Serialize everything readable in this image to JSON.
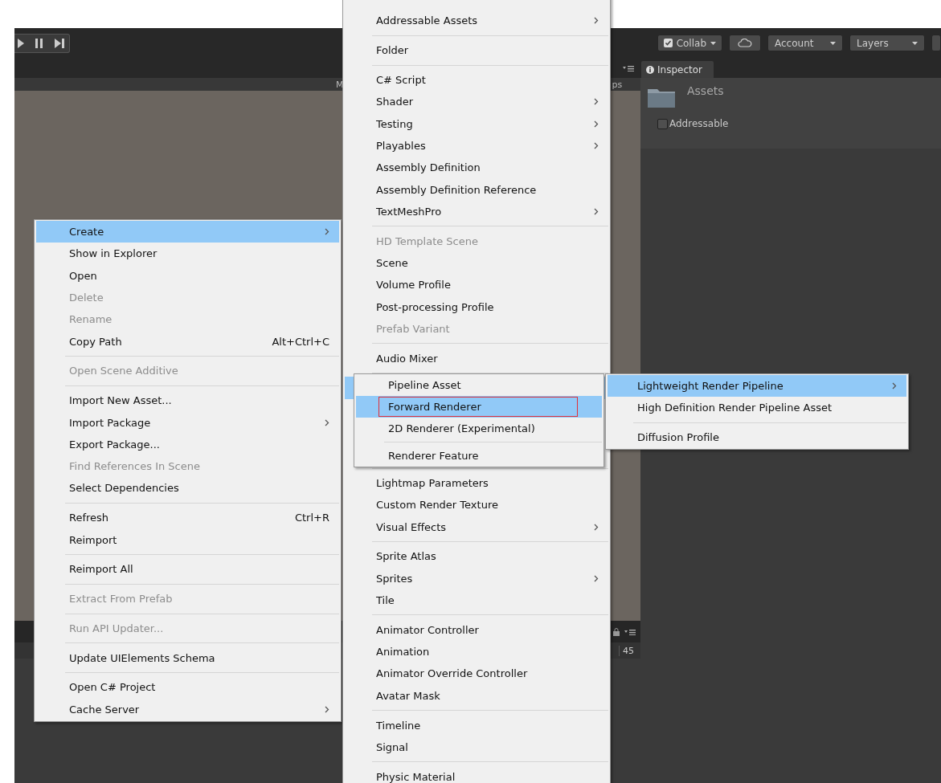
{
  "toolbar": {
    "buttons": [
      {
        "kind": "check_dropdown",
        "label": "Collab"
      },
      {
        "kind": "cloud"
      },
      {
        "kind": "dropdown",
        "label": "Account"
      },
      {
        "kind": "dropdown",
        "label": "Layers"
      }
    ]
  },
  "scene_panel": {
    "header_texts": [
      "M",
      "ps"
    ]
  },
  "inspector": {
    "tab": "Inspector",
    "asset_name": "Assets",
    "addressable": {
      "label": "Addressable",
      "checked": false
    }
  },
  "bottom_panel": {
    "count": "45"
  },
  "context_menu": {
    "items": [
      {
        "kind": "item",
        "label": "Create",
        "selected": true,
        "disabled": false,
        "submenu": true
      },
      {
        "kind": "item",
        "label": "Show in Explorer",
        "selected": false,
        "disabled": false,
        "submenu": false
      },
      {
        "kind": "item",
        "label": "Open",
        "selected": false,
        "disabled": false,
        "submenu": false
      },
      {
        "kind": "item",
        "label": "Delete",
        "selected": false,
        "disabled": true,
        "submenu": false
      },
      {
        "kind": "item",
        "label": "Rename",
        "selected": false,
        "disabled": true,
        "submenu": false
      },
      {
        "kind": "item",
        "label": "Copy Path",
        "shortcut": "Alt+Ctrl+C",
        "selected": false,
        "disabled": false,
        "submenu": false
      },
      {
        "kind": "separator"
      },
      {
        "kind": "item",
        "label": "Open Scene Additive",
        "selected": false,
        "disabled": true,
        "submenu": false
      },
      {
        "kind": "separator"
      },
      {
        "kind": "item",
        "label": "Import New Asset...",
        "selected": false,
        "disabled": false,
        "submenu": false
      },
      {
        "kind": "item",
        "label": "Import Package",
        "selected": false,
        "disabled": false,
        "submenu": true
      },
      {
        "kind": "item",
        "label": "Export Package...",
        "selected": false,
        "disabled": false,
        "submenu": false
      },
      {
        "kind": "item",
        "label": "Find References In Scene",
        "selected": false,
        "disabled": true,
        "submenu": false
      },
      {
        "kind": "item",
        "label": "Select Dependencies",
        "selected": false,
        "disabled": false,
        "submenu": false
      },
      {
        "kind": "separator"
      },
      {
        "kind": "item",
        "label": "Refresh",
        "shortcut": "Ctrl+R",
        "selected": false,
        "disabled": false,
        "submenu": false
      },
      {
        "kind": "item",
        "label": "Reimport",
        "selected": false,
        "disabled": false,
        "submenu": false
      },
      {
        "kind": "separator"
      },
      {
        "kind": "item",
        "label": "Reimport All",
        "selected": false,
        "disabled": false,
        "submenu": false
      },
      {
        "kind": "separator"
      },
      {
        "kind": "item",
        "label": "Extract From Prefab",
        "selected": false,
        "disabled": true,
        "submenu": false
      },
      {
        "kind": "separator"
      },
      {
        "kind": "item",
        "label": "Run API Updater...",
        "selected": false,
        "disabled": true,
        "submenu": false
      },
      {
        "kind": "separator"
      },
      {
        "kind": "item",
        "label": "Update UIElements Schema",
        "selected": false,
        "disabled": false,
        "submenu": false
      },
      {
        "kind": "separator"
      },
      {
        "kind": "item",
        "label": "Open C# Project",
        "selected": false,
        "disabled": false,
        "submenu": false
      },
      {
        "kind": "item",
        "label": "Cache Server",
        "selected": false,
        "disabled": false,
        "submenu": true
      }
    ]
  },
  "create_menu": {
    "items": [
      {
        "kind": "blank"
      },
      {
        "kind": "item",
        "label": "Addressable Assets",
        "selected": false,
        "disabled": false,
        "submenu": true
      },
      {
        "kind": "separator"
      },
      {
        "kind": "item",
        "label": "Folder",
        "selected": false,
        "disabled": false,
        "submenu": false
      },
      {
        "kind": "separator"
      },
      {
        "kind": "item",
        "label": "C# Script",
        "selected": false,
        "disabled": false,
        "submenu": false
      },
      {
        "kind": "item",
        "label": "Shader",
        "selected": false,
        "disabled": false,
        "submenu": true
      },
      {
        "kind": "item",
        "label": "Testing",
        "selected": false,
        "disabled": false,
        "submenu": true
      },
      {
        "kind": "item",
        "label": "Playables",
        "selected": false,
        "disabled": false,
        "submenu": true
      },
      {
        "kind": "item",
        "label": "Assembly Definition",
        "selected": false,
        "disabled": false,
        "submenu": false
      },
      {
        "kind": "item",
        "label": "Assembly Definition Reference",
        "selected": false,
        "disabled": false,
        "submenu": false
      },
      {
        "kind": "item",
        "label": "TextMeshPro",
        "selected": false,
        "disabled": false,
        "submenu": true
      },
      {
        "kind": "separator"
      },
      {
        "kind": "item",
        "label": "HD Template Scene",
        "selected": false,
        "disabled": true,
        "submenu": false
      },
      {
        "kind": "item",
        "label": "Scene",
        "selected": false,
        "disabled": false,
        "submenu": false
      },
      {
        "kind": "item",
        "label": "Volume Profile",
        "selected": false,
        "disabled": false,
        "submenu": false
      },
      {
        "kind": "item",
        "label": "Post-processing Profile",
        "selected": false,
        "disabled": false,
        "submenu": false
      },
      {
        "kind": "item",
        "label": "Prefab Variant",
        "selected": false,
        "disabled": true,
        "submenu": false
      },
      {
        "kind": "separator"
      },
      {
        "kind": "item",
        "label": "Audio Mixer",
        "selected": false,
        "disabled": false,
        "submenu": false
      },
      {
        "kind": "separator"
      },
      {
        "kind": "covered",
        "selected": true
      },
      {
        "kind": "blank"
      },
      {
        "kind": "blank"
      },
      {
        "kind": "blank"
      },
      {
        "kind": "separator"
      },
      {
        "kind": "item",
        "label": "Lightmap Parameters",
        "selected": false,
        "disabled": false,
        "submenu": false
      },
      {
        "kind": "item",
        "label": "Custom Render Texture",
        "selected": false,
        "disabled": false,
        "submenu": false
      },
      {
        "kind": "item",
        "label": "Visual Effects",
        "selected": false,
        "disabled": false,
        "submenu": true
      },
      {
        "kind": "separator"
      },
      {
        "kind": "item",
        "label": "Sprite Atlas",
        "selected": false,
        "disabled": false,
        "submenu": false
      },
      {
        "kind": "item",
        "label": "Sprites",
        "selected": false,
        "disabled": false,
        "submenu": true
      },
      {
        "kind": "item",
        "label": "Tile",
        "selected": false,
        "disabled": false,
        "submenu": false
      },
      {
        "kind": "separator"
      },
      {
        "kind": "item",
        "label": "Animator Controller",
        "selected": false,
        "disabled": false,
        "submenu": false
      },
      {
        "kind": "item",
        "label": "Animation",
        "selected": false,
        "disabled": false,
        "submenu": false
      },
      {
        "kind": "item",
        "label": "Animator Override Controller",
        "selected": false,
        "disabled": false,
        "submenu": false
      },
      {
        "kind": "item",
        "label": "Avatar Mask",
        "selected": false,
        "disabled": false,
        "submenu": false
      },
      {
        "kind": "separator"
      },
      {
        "kind": "item",
        "label": "Timeline",
        "selected": false,
        "disabled": false,
        "submenu": false
      },
      {
        "kind": "item",
        "label": "Signal",
        "selected": false,
        "disabled": false,
        "submenu": false
      },
      {
        "kind": "separator"
      },
      {
        "kind": "item",
        "label": "Physic Material",
        "selected": false,
        "disabled": false,
        "submenu": false
      }
    ]
  },
  "rendering_menu": {
    "items": [
      {
        "kind": "item",
        "label": "Pipeline Asset",
        "selected": false,
        "disabled": false,
        "submenu": false,
        "outlined": false
      },
      {
        "kind": "item",
        "label": "Forward Renderer",
        "selected": true,
        "disabled": false,
        "submenu": false,
        "outlined": true
      },
      {
        "kind": "item",
        "label": "2D Renderer (Experimental)",
        "selected": false,
        "disabled": false,
        "submenu": false,
        "outlined": false
      },
      {
        "kind": "separator"
      },
      {
        "kind": "item",
        "label": "Renderer Feature",
        "selected": false,
        "disabled": false,
        "submenu": false,
        "outlined": false
      }
    ]
  },
  "pipeline_menu": {
    "items": [
      {
        "kind": "item",
        "label": "Lightweight Render Pipeline",
        "selected": true,
        "disabled": false,
        "submenu": true
      },
      {
        "kind": "item",
        "label": "High Definition Render Pipeline Asset",
        "selected": false,
        "disabled": false,
        "submenu": false
      },
      {
        "kind": "separator"
      },
      {
        "kind": "item",
        "label": "Diffusion Profile",
        "selected": false,
        "disabled": false,
        "submenu": false
      }
    ]
  }
}
